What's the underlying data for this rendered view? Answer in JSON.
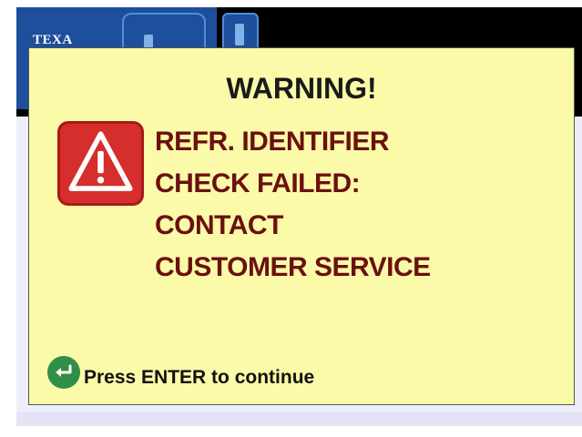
{
  "header": {
    "logo_text": "TEXA"
  },
  "dialog": {
    "title": "WARNING!",
    "message_lines": [
      "REFR. IDENTIFIER",
      "CHECK FAILED:",
      "CONTACT",
      "CUSTOMER SERVICE"
    ],
    "icon": "warning-triangle-icon",
    "enter_hint": "Press ENTER to continue",
    "enter_icon": "enter-key-icon"
  },
  "colors": {
    "dialog_background": "#fafaa8",
    "message_text": "#6b1010",
    "warning_red": "#d62d2d",
    "enter_green": "#2f8f46",
    "header_blue": "#1d4f9c"
  }
}
